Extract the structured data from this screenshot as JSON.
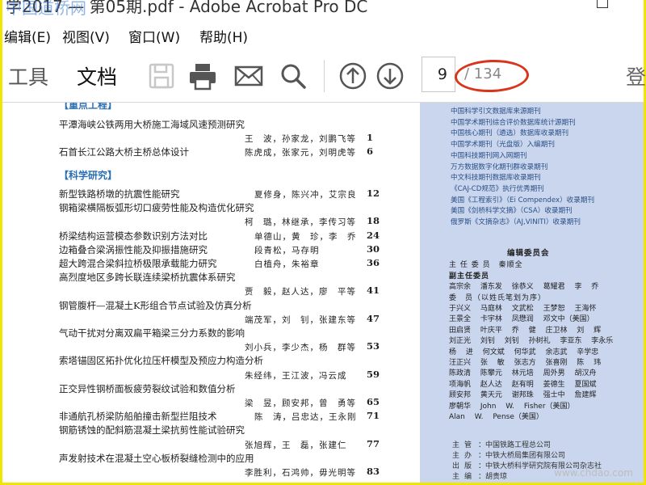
{
  "window": {
    "title": "学2017 — 第05期.pdf - Adobe Acrobat Pro DC",
    "watermark_top": "中国道桥网"
  },
  "menu": [
    "编辑(E)",
    "视图(V)",
    "窗口(W)",
    "帮助(H)"
  ],
  "toolbar": {
    "tabs": [
      "工具",
      "文档"
    ],
    "icons": [
      "save-icon",
      "print-icon",
      "email-icon",
      "search-icon",
      "prev-page-icon",
      "next-page-icon"
    ],
    "current_page": "9",
    "page_total": "/ 134",
    "sign_label": "登"
  },
  "document": {
    "top_section_partial": "【重点工程】",
    "entries_top": [
      {
        "title": "平潭海峡公铁两用大桥施工海域风速预测研究",
        "authors": "王　波，孙家龙，刘鹏飞等",
        "page": "1"
      },
      {
        "title": "石首长江公路大桥主桥总体设计",
        "authors": "陈虎成，张家元，刘明虎等",
        "page": "6"
      }
    ],
    "section_research": "【科学研究】",
    "entries_research": [
      {
        "title": "新型铁路桥墩的抗震性能研究",
        "authors": "夏修身，陈兴冲，艾宗良",
        "page": "12"
      },
      {
        "title": "钢箱梁横隔板弧形切口疲劳性能及构造优化研究",
        "authors": "",
        "page": ""
      },
      {
        "title": "",
        "authors": "柯　璐，林继承，李传习等",
        "page": "18"
      },
      {
        "title": "桥梁结构运营模态参数识别方法对比",
        "authors": "单德山，黄　珍，李　乔",
        "page": "24"
      },
      {
        "title": "边箱叠合梁涡振性能及抑振措施研究",
        "authors": "段青松，马存明",
        "page": "30"
      },
      {
        "title": "超大跨混合梁斜拉桥极限承载能力研究",
        "authors": "白植舟，朱裕章",
        "page": "36"
      },
      {
        "title": "高烈度地区多跨长联连续梁桥抗震体系研究",
        "authors": "",
        "page": ""
      },
      {
        "title": "",
        "authors": "贾　毅，赵人达，廖　平等",
        "page": "41"
      },
      {
        "title": "钢管腹杆—混凝土K形组合节点试验及仿真分析",
        "authors": "",
        "page": ""
      },
      {
        "title": "",
        "authors": "端茂军，刘　钊，张建东等",
        "page": "47"
      },
      {
        "title": "气动干扰对分离双扁平箱梁三分力系数的影响",
        "authors": "",
        "page": ""
      },
      {
        "title": "",
        "authors": "刘小兵，李少杰，杨　群等",
        "page": "53"
      },
      {
        "title": "索塔锚固区拓扑优化拉压杆模型及预应力构造分析",
        "authors": "",
        "page": ""
      },
      {
        "title": "",
        "authors": "朱经纬，王江波，冯云成",
        "page": "59"
      },
      {
        "title": "正交异性钢桥面板疲劳裂纹试验和数值分析",
        "authors": "",
        "page": ""
      },
      {
        "title": "",
        "authors": "梁　昱，顾安邦，曾　勇等",
        "page": "65"
      },
      {
        "title": "非通航孔桥梁防船舶撞击新型拦阻技术",
        "authors": "陈　涛，吕忠达，王永刚",
        "page": "71"
      },
      {
        "title": "钢筋锈蚀的配斜筋混凝土梁抗剪性能试验研究",
        "authors": "",
        "page": ""
      },
      {
        "title": "",
        "authors": "张旭辉，王　磊，张建仁",
        "page": "77"
      },
      {
        "title": "声发射技术在混凝土空心板桥裂缝检测中的应用",
        "authors": "",
        "page": ""
      },
      {
        "title": "",
        "authors": "李胜利，石鸿帅，毋光明等",
        "page": "83"
      }
    ],
    "indexing": [
      "中国科学引文数据库来源期刊",
      "中国学术期刊综合评价数据库统计源期刊",
      "中国核心期刊（遴选）数据库收录期刊",
      "中国学术期刊（光盘版）入编期刊",
      "中国科技期刊网入网期刊",
      "万方数据数字化期刊群收录期刊",
      "中文科技期刊数据库收录期刊",
      "《CAJ-CD规范》执行优秀期刊",
      "美国《工程索引》（Ei Compendex）收录期刊",
      "美国《剑桥科学文摘》（CSA）收录期刊",
      "俄罗斯《文摘杂志》（AJ,VINITI）收录期刊"
    ],
    "board": {
      "title": "编辑委员会",
      "director": "主 任 委 员　秦顺全",
      "vice_label": "副主任委员",
      "vice_names": "高宗余 潘东发 徐恭义 葛耀君 李 乔",
      "members_label": "委　员（以姓氏笔划为序）",
      "member_lines": [
        "于兴义 马庭林 文武松 王梦恕 王海怀",
        "王景全 卡宇林 凤懋润 邓文中（美国）",
        "田启贤 叶庆平 乔 健 庄卫林 刘 辉",
        "刘正光 刘钊 刘钊 孙树礼 李亚东 李永乐",
        "杨 进 何文斌 何华武 余志武 辛学忠",
        "汪正兴 张 敏 张志方 张喜刚 陈 玮",
        "陈政清 陈攀元 林元培 周外男 胡汉舟",
        "项海帆 赵人达 赵有明 姜德生 夏国斌",
        "顾安邦 黄天元 谢邦珠 强士中 詹建辉",
        "廖朝华 John W. Fisher（美国）",
        "Alan W. Pense（美国）"
      ]
    },
    "publication": [
      {
        "key": "主管",
        "value": "中国铁路工程总公司"
      },
      {
        "key": "主办",
        "value": "中铁大桥局集团有限公司"
      },
      {
        "key": "出版",
        "value": "中铁大桥科学研究院有限公司杂志社"
      },
      {
        "key": "主编",
        "value": "胡贵琼"
      }
    ],
    "watermark_bottom": "www.chdao.com"
  },
  "colors": {
    "accent_red": "#d9351c",
    "section_blue": "#2a6fb3",
    "right_column_bg": "#c9d6ee",
    "frame_yellow": "#f2e600"
  }
}
